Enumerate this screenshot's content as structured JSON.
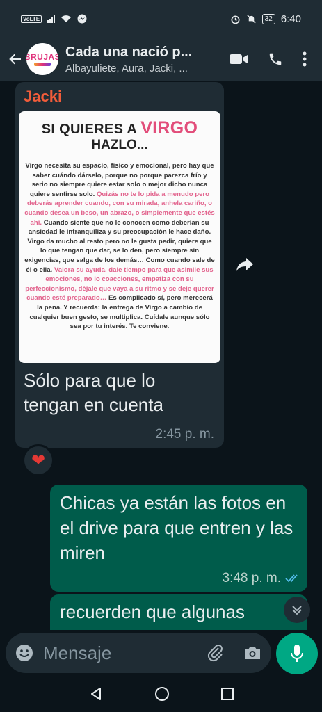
{
  "status_bar": {
    "carrier_badge": "VoLTE",
    "battery": "32",
    "time": "6:40"
  },
  "header": {
    "avatar_text": "BRUJAS",
    "title": "Cada una nació p...",
    "subtitle": "Albayuliete, Aura, Jacki, ..."
  },
  "messages": {
    "incoming": {
      "sender": "Jacki",
      "image_card": {
        "heading_prefix": "SI QUIERES A ",
        "heading_highlight": "VIRGO",
        "heading_line2": "HAZLO...",
        "body_1": "Virgo necesita su espacio, físico y emocional, pero hay que saber cuándo dárselo, porque no porque parezca frío y serio no siempre quiere estar solo o mejor dicho nunca quiere sentirse solo. ",
        "body_2": "Quizás no te lo pida a menudo pero deberás aprender cuando, con su mirada, anhela cariño, o cuando desea un beso, un abrazo, o simplemente que estés ahí.",
        "body_3": " Cuando siente que no le conocen como deberían su ansiedad le intranquiliza y su preocupación le hace daño. Virgo da mucho al resto pero no le gusta pedir, quiere que lo que tengan que dar, se lo den, pero siempre sin exigencias, que salga de los demás… Como cuando sale de él o ella. ",
        "body_4": "Valora su ayuda, dale tiempo para que asimile sus emociones, no lo coacciones, empatiza con su perfeccionismo, déjale que vaya a su ritmo y se deje querer cuando esté preparado…",
        "body_5": " Es complicado sí, pero merecerá la pena. Y recuerda: la entrega de Virgo a cambio de cualquier buen gesto, se multiplica. Cuídale aunque sólo sea por tu interés. Te conviene."
      },
      "caption": "Sólo para que lo tengan en cuenta",
      "time": "2:45 p. m.",
      "reaction": "❤"
    },
    "outgoing_1": {
      "text": "Chicas ya están las fotos en el drive para que entren y las miren",
      "time": "3:48 p. m."
    },
    "outgoing_2": {
      "text": "recuerden que algunas"
    }
  },
  "composer": {
    "placeholder": "Mensaje"
  },
  "colors": {
    "header_bg": "#1f2c34",
    "chat_bg": "#0b141a",
    "outgoing_bubble": "#005c4b",
    "sender_name": "#f15c3a",
    "mic_button": "#00a884",
    "read_ticks": "#53bdeb"
  }
}
